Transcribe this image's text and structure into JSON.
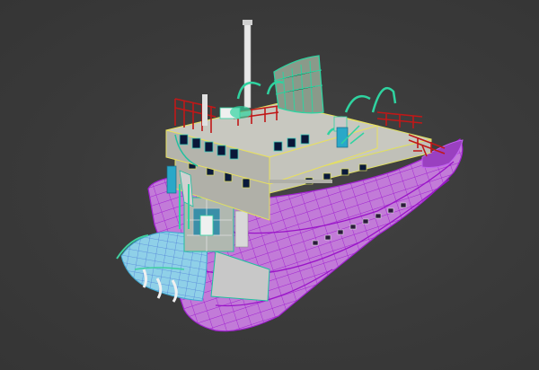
{
  "viewport": {
    "name": "3d-viewport",
    "background": "#3b3b3b"
  },
  "model": {
    "name": "tugboat-wireframe-model",
    "colors": {
      "hull_wire": "#c040e8",
      "hull_fill": "#c77be0",
      "superstructure_fill": "#b8b8b0",
      "superstructure_wire": "#e8e060",
      "rails": "#c01818",
      "fittings": "#2fd3a0",
      "pipes": "#e6e6e6",
      "teal_parts": "#2aa8c8"
    }
  }
}
